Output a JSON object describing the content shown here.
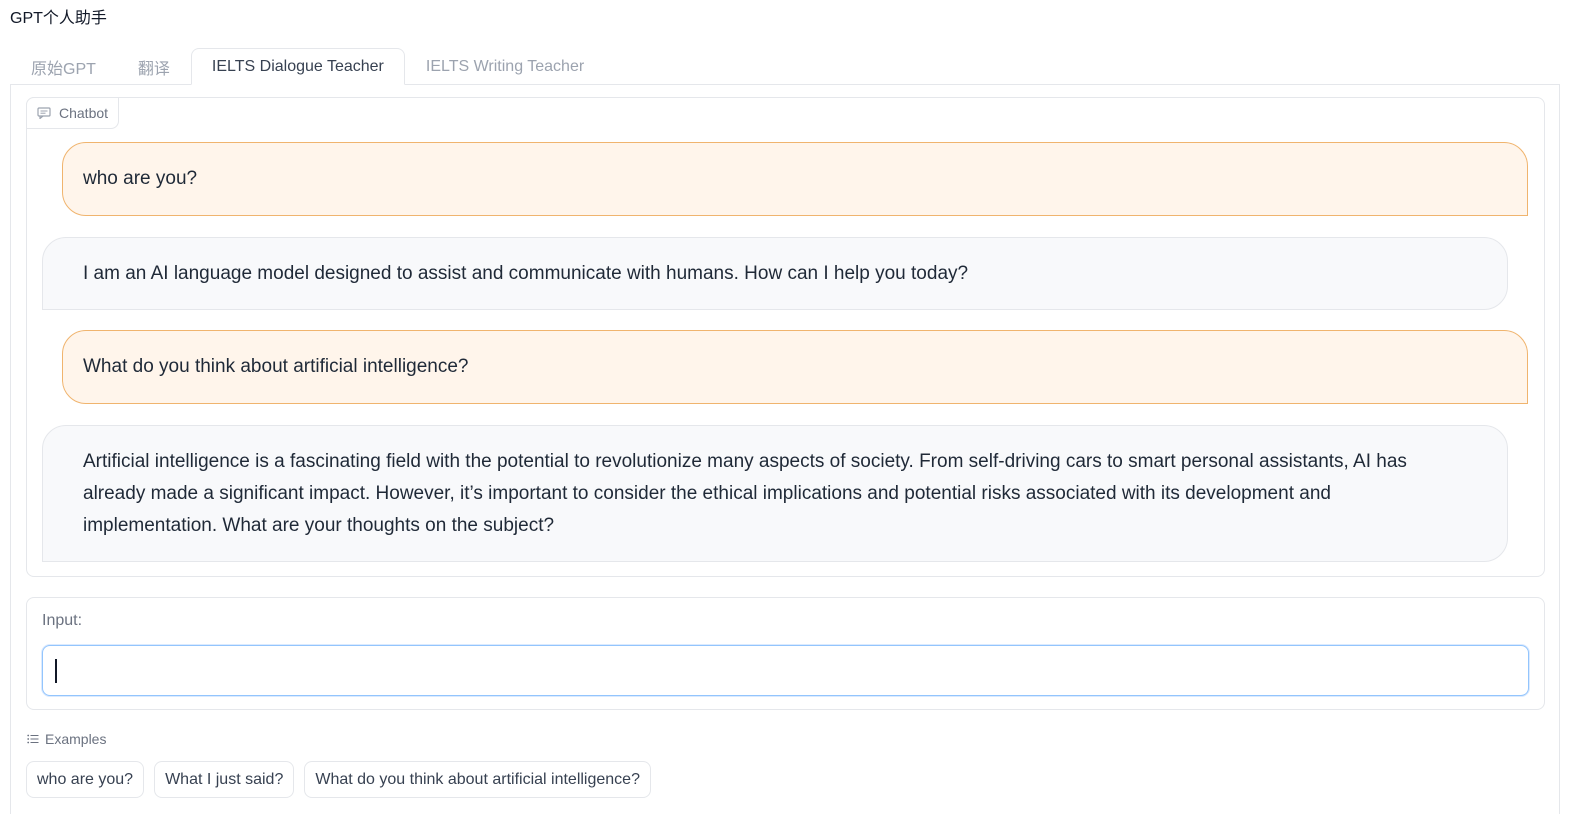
{
  "app": {
    "title": "GPT个人助手"
  },
  "tabs": [
    {
      "label": "原始GPT",
      "active": false
    },
    {
      "label": "翻译",
      "active": false
    },
    {
      "label": "IELTS Dialogue Teacher",
      "active": true
    },
    {
      "label": "IELTS Writing Teacher",
      "active": false
    }
  ],
  "chatbot": {
    "label": "Chatbot",
    "icon": "chat-icon",
    "messages": [
      {
        "role": "user",
        "text": "who are you?"
      },
      {
        "role": "bot",
        "text": "I am an AI language model designed to assist and communicate with humans. How can I help you today?"
      },
      {
        "role": "user",
        "text": "What do you think about artificial intelligence?"
      },
      {
        "role": "bot",
        "text": "Artificial intelligence is a fascinating field with the potential to revolutionize many aspects of society. From self-driving cars to smart personal assistants, AI has already made a significant impact. However, it’s important to consider the ethical implications and potential risks associated with its development and implementation. What are your thoughts on the subject?"
      }
    ]
  },
  "input": {
    "label": "Input:",
    "value": "",
    "placeholder": ""
  },
  "examples": {
    "label": "Examples",
    "icon": "list-icon",
    "items": [
      "who are you?",
      "What I just said?",
      "What do you think about artificial intelligence?"
    ]
  },
  "colors": {
    "user_bubble_bg": "#fff5eb",
    "user_bubble_border": "#f0b46e",
    "bot_bubble_bg": "#f8f9fb",
    "input_focus_border": "#93c5fd"
  }
}
